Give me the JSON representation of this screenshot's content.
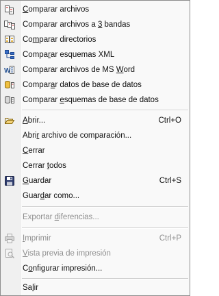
{
  "menu": {
    "items": [
      {
        "pre": "",
        "key": "C",
        "post": "omparar archivos",
        "shortcut": "",
        "icon": "compare-files-icon",
        "enabled": true
      },
      {
        "pre": "Comparar archivos a ",
        "key": "3",
        "post": " bandas",
        "shortcut": "",
        "icon": "compare-3way-icon",
        "enabled": true
      },
      {
        "pre": "Co",
        "key": "m",
        "post": "parar directorios",
        "shortcut": "",
        "icon": "compare-directories-icon",
        "enabled": true
      },
      {
        "pre": "Compa",
        "key": "r",
        "post": "ar esquemas XML",
        "shortcut": "",
        "icon": "compare-xml-schemas-icon",
        "enabled": true
      },
      {
        "pre": "Comparar archivos de MS ",
        "key": "W",
        "post": "ord",
        "shortcut": "",
        "icon": "compare-word-icon",
        "enabled": true
      },
      {
        "pre": "Compar",
        "key": "a",
        "post": "r datos de base de datos",
        "shortcut": "",
        "icon": "compare-db-data-icon",
        "enabled": true
      },
      {
        "pre": "Comparar ",
        "key": "e",
        "post": "squemas de base de datos",
        "shortcut": "",
        "icon": "compare-db-schemas-icon",
        "enabled": true
      },
      {
        "pre": "",
        "key": "A",
        "post": "brir...",
        "shortcut": "Ctrl+O",
        "icon": "open-folder-icon",
        "enabled": true
      },
      {
        "pre": "Abri",
        "key": "r",
        "post": " archivo de comparación...",
        "shortcut": "",
        "icon": "",
        "enabled": true
      },
      {
        "pre": "",
        "key": "C",
        "post": "errar",
        "shortcut": "",
        "icon": "",
        "enabled": true
      },
      {
        "pre": "Cerrar ",
        "key": "t",
        "post": "odos",
        "shortcut": "",
        "icon": "",
        "enabled": true
      },
      {
        "pre": "",
        "key": "G",
        "post": "uardar",
        "shortcut": "Ctrl+S",
        "icon": "save-icon",
        "enabled": true
      },
      {
        "pre": "Guar",
        "key": "d",
        "post": "ar como...",
        "shortcut": "",
        "icon": "",
        "enabled": true
      },
      {
        "pre": "Exportar ",
        "key": "d",
        "post": "iferencias...",
        "shortcut": "",
        "icon": "",
        "enabled": false
      },
      {
        "pre": "",
        "key": "I",
        "post": "mprimir",
        "shortcut": "Ctrl+P",
        "icon": "print-icon",
        "enabled": false
      },
      {
        "pre": "",
        "key": "V",
        "post": "ista previa de impresión",
        "shortcut": "",
        "icon": "print-preview-icon",
        "enabled": false
      },
      {
        "pre": "C",
        "key": "o",
        "post": "nfigurar impresión...",
        "shortcut": "",
        "icon": "",
        "enabled": true
      },
      {
        "pre": "Sa",
        "key": "l",
        "post": "ir",
        "shortcut": "",
        "icon": "",
        "enabled": true
      }
    ]
  }
}
